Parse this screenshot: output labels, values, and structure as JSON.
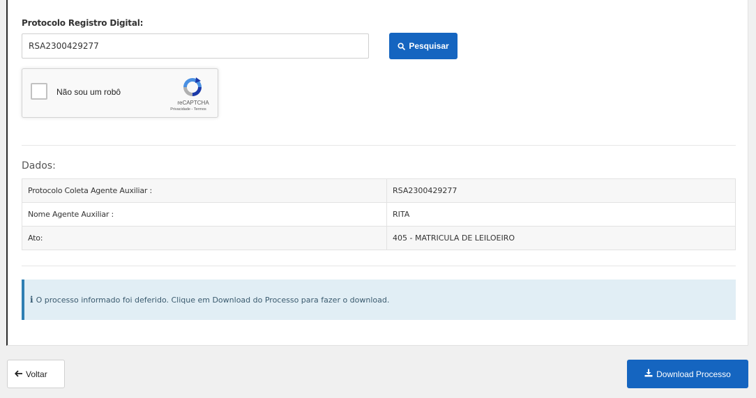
{
  "form": {
    "protocol_label": "Protocolo Registro Digital:",
    "protocol_value": "RSA2300429277",
    "search_button_label": "Pesquisar",
    "search_icon": "search-icon"
  },
  "recaptcha": {
    "label": "Não sou um robô",
    "brand": "reCAPTCHA",
    "terms": "Privacidade - Termos",
    "checked": false
  },
  "dados": {
    "title": "Dados:",
    "rows": [
      {
        "key": "Protocolo Coleta Agente Auxiliar :",
        "value": "RSA2300429277"
      },
      {
        "key": "Nome Agente Auxiliar :",
        "value": "RITA"
      },
      {
        "key": "Ato:",
        "value": "405 - MATRICULA DE LEILOEIRO"
      }
    ]
  },
  "alert": {
    "icon": "info-icon",
    "text": "O processo informado foi deferido. Clique em Download do Processo para fazer o download."
  },
  "footer": {
    "back_label": "Voltar",
    "back_icon": "arrow-left-icon",
    "download_label": "Download Processo",
    "download_icon": "download-icon"
  },
  "colors": {
    "primary": "#1565c0",
    "alert_background": "#e1eef5",
    "alert_border": "#2f7fb3"
  }
}
